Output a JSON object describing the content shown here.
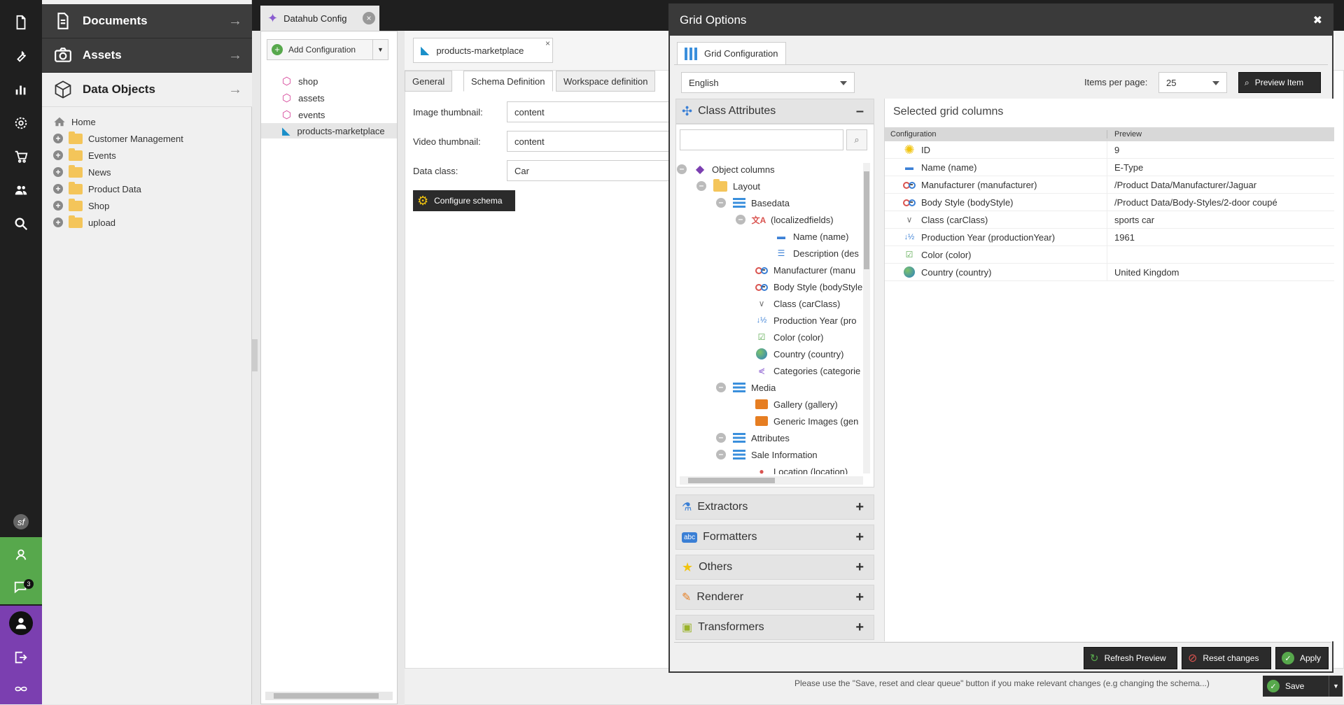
{
  "nav": {
    "icons": [
      "document-icon",
      "wrench-icon",
      "chart-icon",
      "gear-icon",
      "cart-icon",
      "users-icon",
      "search-icon"
    ],
    "bottom_icons": [
      "symfony-icon",
      "user-circle-icon",
      "chat-icon",
      "profile-icon",
      "logout-icon",
      "pimcore-logo-icon"
    ],
    "chat_badge": "3"
  },
  "tree": {
    "sections": [
      {
        "label": "Documents",
        "icon": "document-icon"
      },
      {
        "label": "Assets",
        "icon": "camera-icon"
      },
      {
        "label": "Data Objects",
        "icon": "cube-icon"
      }
    ],
    "home": "Home",
    "folders": [
      "Customer Management",
      "Events",
      "News",
      "Product Data",
      "Shop",
      "upload"
    ]
  },
  "tabs": {
    "main_tab": "Datahub Config"
  },
  "config_tree": {
    "add_label": "Add Configuration",
    "items": [
      "shop",
      "assets",
      "events",
      "products-marketplace"
    ]
  },
  "editor": {
    "config_tab": "products-marketplace",
    "subtabs": [
      "General",
      "Schema Definition",
      "Workspace definition"
    ],
    "fields": [
      {
        "label": "Image thumbnail:",
        "value": "content"
      },
      {
        "label": "Video thumbnail:",
        "value": "content"
      },
      {
        "label": "Data class:",
        "value": "Car"
      }
    ],
    "configure_button": "Configure schema",
    "footer_note": "Please use the \"Save, reset and clear queue\" button if you make relevant changes (e.g changing the schema...)",
    "save_label": "Save"
  },
  "modal": {
    "title": "Grid Options",
    "tab": "Grid Configuration",
    "language": "English",
    "items_per_page_label": "Items per page:",
    "items_per_page": "25",
    "preview_item": "Preview Item",
    "class_attributes_title": "Class Attributes",
    "class_tree": [
      {
        "label": "Object columns",
        "level": 0,
        "toggle": true
      },
      {
        "label": "Layout",
        "level": 1,
        "toggle": true
      },
      {
        "label": "Basedata",
        "level": 2,
        "toggle": true
      },
      {
        "label": "(localizedfields)",
        "level": 3,
        "toggle": true
      },
      {
        "label": "Name (name)",
        "level": 4,
        "toggle": false
      },
      {
        "label": "Description (des",
        "level": 4,
        "toggle": false
      },
      {
        "label": "Manufacturer (manu",
        "level": 3,
        "toggle": false
      },
      {
        "label": "Body Style (bodyStyle",
        "level": 3,
        "toggle": false
      },
      {
        "label": "Class (carClass)",
        "level": 3,
        "toggle": false
      },
      {
        "label": "Production Year (pro",
        "level": 3,
        "toggle": false
      },
      {
        "label": "Color (color)",
        "level": 3,
        "toggle": false
      },
      {
        "label": "Country (country)",
        "level": 3,
        "toggle": false
      },
      {
        "label": "Categories (categorie",
        "level": 3,
        "toggle": false
      },
      {
        "label": "Media",
        "level": 2,
        "toggle": true
      },
      {
        "label": "Gallery (gallery)",
        "level": 3,
        "toggle": false
      },
      {
        "label": "Generic Images (gen",
        "level": 3,
        "toggle": false
      },
      {
        "label": "Attributes",
        "level": 2,
        "toggle": true
      },
      {
        "label": "Sale Information",
        "level": 2,
        "toggle": true
      },
      {
        "label": "Location (location)",
        "level": 3,
        "toggle": false
      }
    ],
    "panels": [
      "Extractors",
      "Formatters",
      "Others",
      "Renderer",
      "Transformers"
    ],
    "selected_title": "Selected grid columns",
    "grid_headers": [
      "Configuration",
      "Preview"
    ],
    "grid_rows": [
      {
        "config": "ID",
        "preview": "9"
      },
      {
        "config": "Name (name)",
        "preview": "E-Type"
      },
      {
        "config": "Manufacturer (manufacturer)",
        "preview": "/Product Data/Manufacturer/Jaguar"
      },
      {
        "config": "Body Style (bodyStyle)",
        "preview": "/Product Data/Body-Styles/2-door coupé"
      },
      {
        "config": "Class (carClass)",
        "preview": "sports car"
      },
      {
        "config": "Production Year (productionYear)",
        "preview": "1961"
      },
      {
        "config": "Color (color)",
        "preview": ""
      },
      {
        "config": "Country (country)",
        "preview": "United Kingdom"
      }
    ],
    "refresh_preview": "Refresh Preview",
    "reset_changes": "Reset changes",
    "apply": "Apply"
  }
}
